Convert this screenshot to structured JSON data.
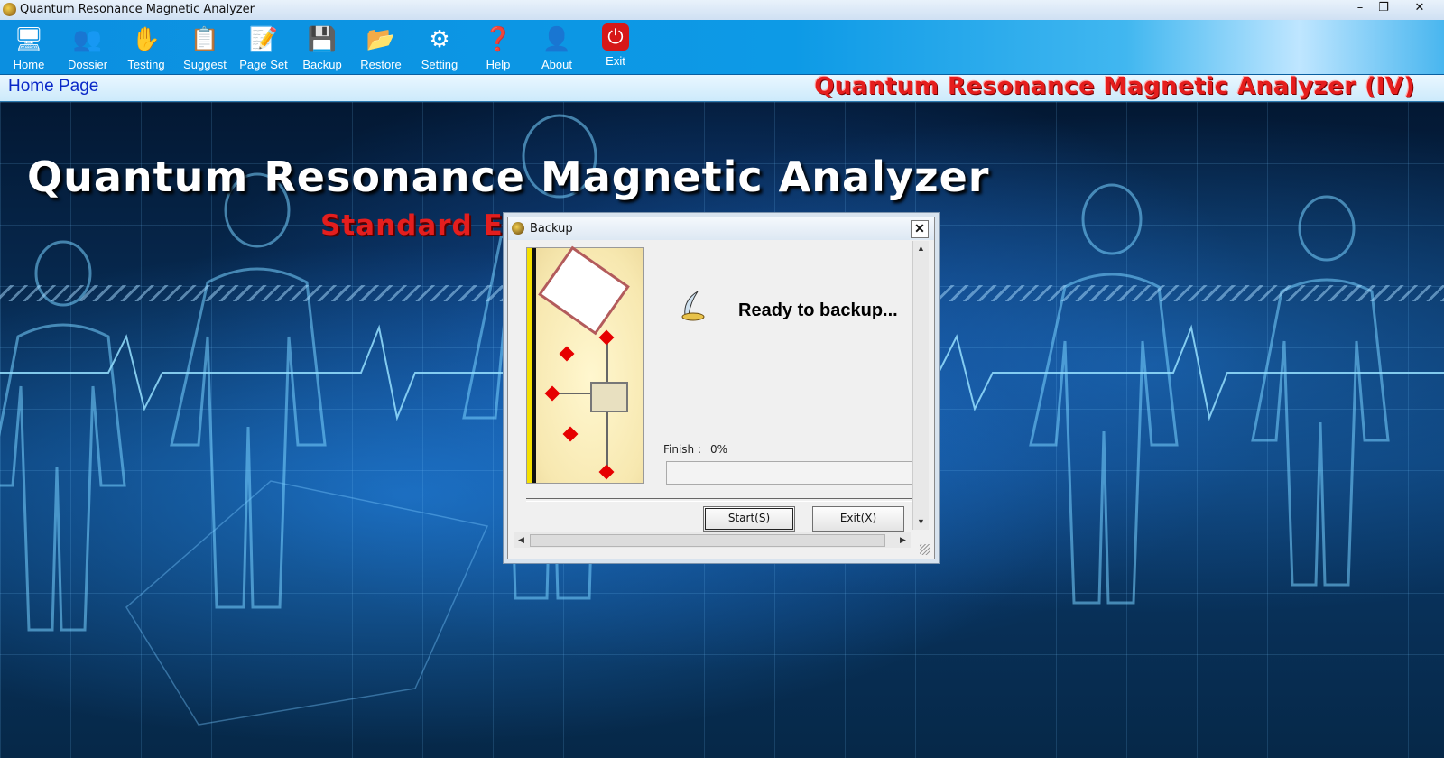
{
  "window": {
    "title": "Quantum Resonance Magnetic Analyzer",
    "controls": {
      "minimize": "–",
      "restore": "❐",
      "close": "✕"
    }
  },
  "toolbar": {
    "items": [
      {
        "label": "Home",
        "icon": "home-icon",
        "glyph": "🖥"
      },
      {
        "label": "Dossier",
        "icon": "users-icon",
        "glyph": "👥"
      },
      {
        "label": "Testing",
        "icon": "hand-icon",
        "glyph": "✋"
      },
      {
        "label": "Suggest",
        "icon": "document-icon",
        "glyph": "📋"
      },
      {
        "label": "Page Set",
        "icon": "page-edit-icon",
        "glyph": "📝"
      },
      {
        "label": "Backup",
        "icon": "backup-icon",
        "glyph": "💾"
      },
      {
        "label": "Restore",
        "icon": "restore-icon",
        "glyph": "📂"
      },
      {
        "label": "Setting",
        "icon": "gear-icon",
        "glyph": "⚙"
      },
      {
        "label": "Help",
        "icon": "help-icon",
        "glyph": "❓"
      },
      {
        "label": "About",
        "icon": "about-icon",
        "glyph": "👤"
      },
      {
        "label": "Exit",
        "icon": "power-icon",
        "glyph": "⏻"
      }
    ]
  },
  "breadcrumb": {
    "label": "Home Page"
  },
  "brand": {
    "text": "Quantum Resonance Magnetic Analyzer (IV)"
  },
  "hero": {
    "title": "Quantum Resonance Magnetic Analyzer",
    "subtitle": "Standard E"
  },
  "dialog": {
    "title": "Backup",
    "close": "✕",
    "status": "Ready to backup...",
    "finish_label": "Finish :",
    "finish_value": "0%",
    "progress": 0,
    "start_button": "Start(S)",
    "exit_button": "Exit(X)"
  },
  "colors": {
    "accent": "#0d9ae6",
    "brand_red": "#e51d1d",
    "link_blue": "#0a28c8"
  }
}
